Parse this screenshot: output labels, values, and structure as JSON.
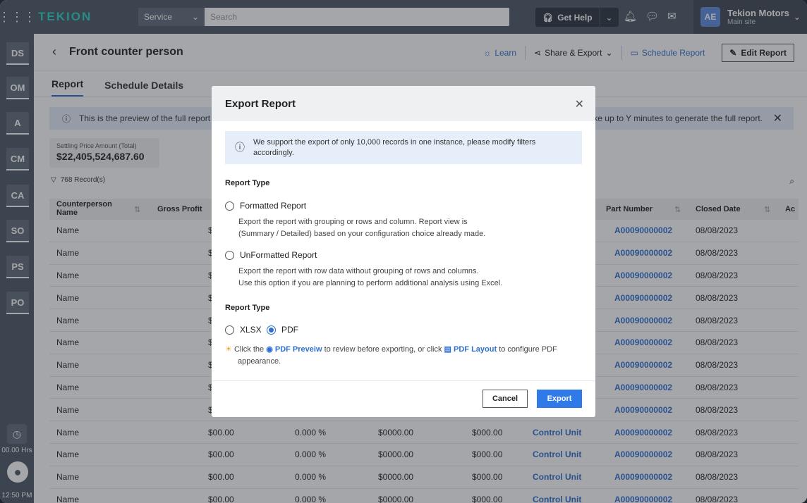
{
  "topbar": {
    "logo": "TEKION",
    "service_label": "Service",
    "search_placeholder": "Search",
    "help_label": "Get Help",
    "account_initials": "AE",
    "account_name": "Tekion Motors",
    "account_site": "Main site"
  },
  "sidebar": {
    "items": [
      "DS",
      "OM",
      "A",
      "CM",
      "CA",
      "SO",
      "PS",
      "PO"
    ],
    "timer": "00.00 Hrs",
    "clock_time": "12:50 PM"
  },
  "header": {
    "title": "Front counter person",
    "learn": "Learn",
    "share_export": "Share & Export",
    "schedule_report": "Schedule Report",
    "edit_report": "Edit Report"
  },
  "tabs": [
    {
      "label": "Report",
      "active": true
    },
    {
      "label": "Schedule Details",
      "active": false
    }
  ],
  "banner": {
    "text_start": "This is the preview of the full report wh",
    "text_end": "take up to Y minutes to generate the full report."
  },
  "stat": {
    "label": "Settling Price Amount (Total)",
    "value": "$22,405,524,687.60"
  },
  "records": "768 Record(s)",
  "table": {
    "headers": {
      "counterperson": "Counterperson Name",
      "gross_profit": "Gross Profit",
      "part_number": "Part Number",
      "closed_date": "Closed Date",
      "next": "Ac"
    },
    "rows": [
      {
        "name": "Name",
        "gp": "$",
        "pct": "",
        "amt": "",
        "cost": "",
        "unit": "",
        "part": "A00090000002",
        "date": "08/08/2023"
      },
      {
        "name": "Name",
        "gp": "$",
        "pct": "",
        "amt": "",
        "cost": "",
        "unit": "",
        "part": "A00090000002",
        "date": "08/08/2023"
      },
      {
        "name": "Name",
        "gp": "$",
        "pct": "",
        "amt": "",
        "cost": "",
        "unit": "",
        "part": "A00090000002",
        "date": "08/08/2023"
      },
      {
        "name": "Name",
        "gp": "$",
        "pct": "",
        "amt": "",
        "cost": "",
        "unit": "",
        "part": "A00090000002",
        "date": "08/08/2023"
      },
      {
        "name": "Name",
        "gp": "$",
        "pct": "",
        "amt": "",
        "cost": "",
        "unit": "",
        "part": "A00090000002",
        "date": "08/08/2023"
      },
      {
        "name": "Name",
        "gp": "$",
        "pct": "",
        "amt": "",
        "cost": "",
        "unit": "",
        "part": "A00090000002",
        "date": "08/08/2023"
      },
      {
        "name": "Name",
        "gp": "$",
        "pct": "",
        "amt": "",
        "cost": "",
        "unit": "",
        "part": "A00090000002",
        "date": "08/08/2023"
      },
      {
        "name": "Name",
        "gp": "$",
        "pct": "",
        "amt": "",
        "cost": "",
        "unit": "",
        "part": "A00090000002",
        "date": "08/08/2023"
      },
      {
        "name": "Name",
        "gp": "$",
        "pct": "",
        "amt": "",
        "cost": "",
        "unit": "",
        "part": "A00090000002",
        "date": "08/08/2023"
      },
      {
        "name": "Name",
        "gp": "$00.00",
        "pct": "0.000 %",
        "amt": "$0000.00",
        "cost": "$000.00",
        "unit": "Control Unit",
        "part": "A00090000002",
        "date": "08/08/2023"
      },
      {
        "name": "Name",
        "gp": "$00.00",
        "pct": "0.000 %",
        "amt": "$0000.00",
        "cost": "$000.00",
        "unit": "Control Unit",
        "part": "A00090000002",
        "date": "08/08/2023"
      },
      {
        "name": "Name",
        "gp": "$00.00",
        "pct": "0.000 %",
        "amt": "$0000.00",
        "cost": "$000.00",
        "unit": "Control Unit",
        "part": "A00090000002",
        "date": "08/08/2023"
      },
      {
        "name": "Name",
        "gp": "$00.00",
        "pct": "0.000 %",
        "amt": "$0000.00",
        "cost": "$000.00",
        "unit": "Control Unit",
        "part": "A00090000002",
        "date": "08/08/2023"
      }
    ]
  },
  "modal": {
    "title": "Export Report",
    "info": "We support the export of only 10,000 records in one instance, please modify filters accordingly.",
    "report_type_label": "Report Type",
    "formatted": {
      "label": "Formatted Report",
      "desc1": "Export the report with grouping or rows and column. Report view is",
      "desc2": "(Summary / Detailed) based on your configuration choice already made."
    },
    "unformatted": {
      "label": "UnFormatted Report",
      "desc1": "Export the report with row data without grouping of rows and columns.",
      "desc2": "Use this option if you are planning to perform additional analysis using Excel."
    },
    "file_type_label": "Report Type",
    "xlsx": "XLSX",
    "pdf": "PDF",
    "hint_click": "Click the",
    "hint_preview": "PDF Preveiw",
    "hint_mid": "to review before exporting, or click",
    "hint_layout": "PDF Layout",
    "hint_end": "to configure PDF",
    "hint_end2": "appearance.",
    "cancel": "Cancel",
    "export": "Export"
  }
}
